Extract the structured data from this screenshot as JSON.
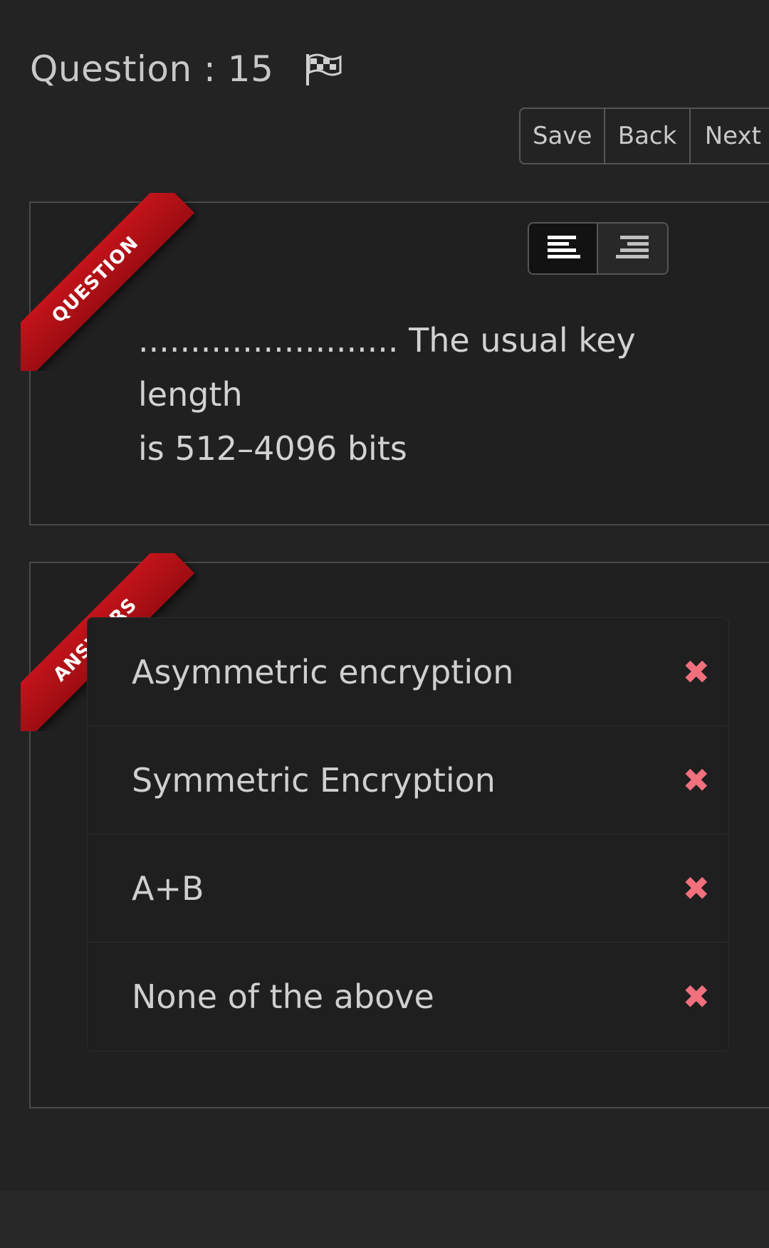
{
  "header": {
    "question_label": "Question : 15",
    "flag_icon": "checkered-flag-icon"
  },
  "toolbar": {
    "save_label": "Save",
    "back_label": "Back",
    "next_label": "Next"
  },
  "question": {
    "ribbon_label": "QUESTION",
    "text_line1": "......................... The usual key length",
    "text_line2": "is 512–4096 bits",
    "align_options": [
      "align-left-icon",
      "align-right-icon"
    ],
    "active_align": "align-left"
  },
  "answers": {
    "ribbon_label": "ANSWERS",
    "items": [
      {
        "label": "Asymmetric encryption",
        "mark": "✖"
      },
      {
        "label": "Symmetric Encryption",
        "mark": "✖"
      },
      {
        "label": "A+B",
        "mark": "✖"
      },
      {
        "label": "None of the above",
        "mark": "✖"
      }
    ]
  },
  "colors": {
    "background": "#232323",
    "ribbon": "#b0121a",
    "wrong_mark": "#f0707e"
  }
}
